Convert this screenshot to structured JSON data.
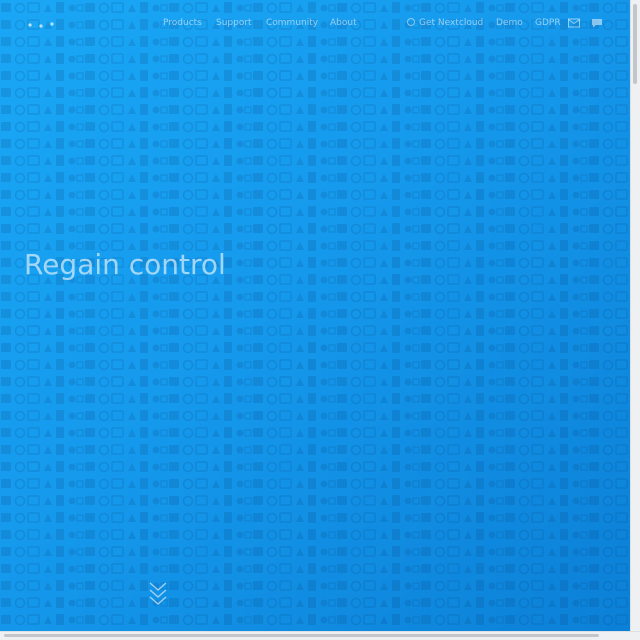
{
  "nav": {
    "products": "Products",
    "support": "Support",
    "community": "Community",
    "about": "About",
    "get_nextcloud": "Get Nextcloud",
    "demo": "Demo",
    "gdpr": "GDPR",
    "icons": [
      "logo-icon",
      "mail-icon",
      "chat-icon",
      "cloud-icon",
      "chevron-down-icon"
    ]
  },
  "hero": {
    "title": "Regain control"
  },
  "colors": {
    "background_start": "#1aa7f6",
    "background_end": "#0b7fd6",
    "text": "#ffffff"
  }
}
